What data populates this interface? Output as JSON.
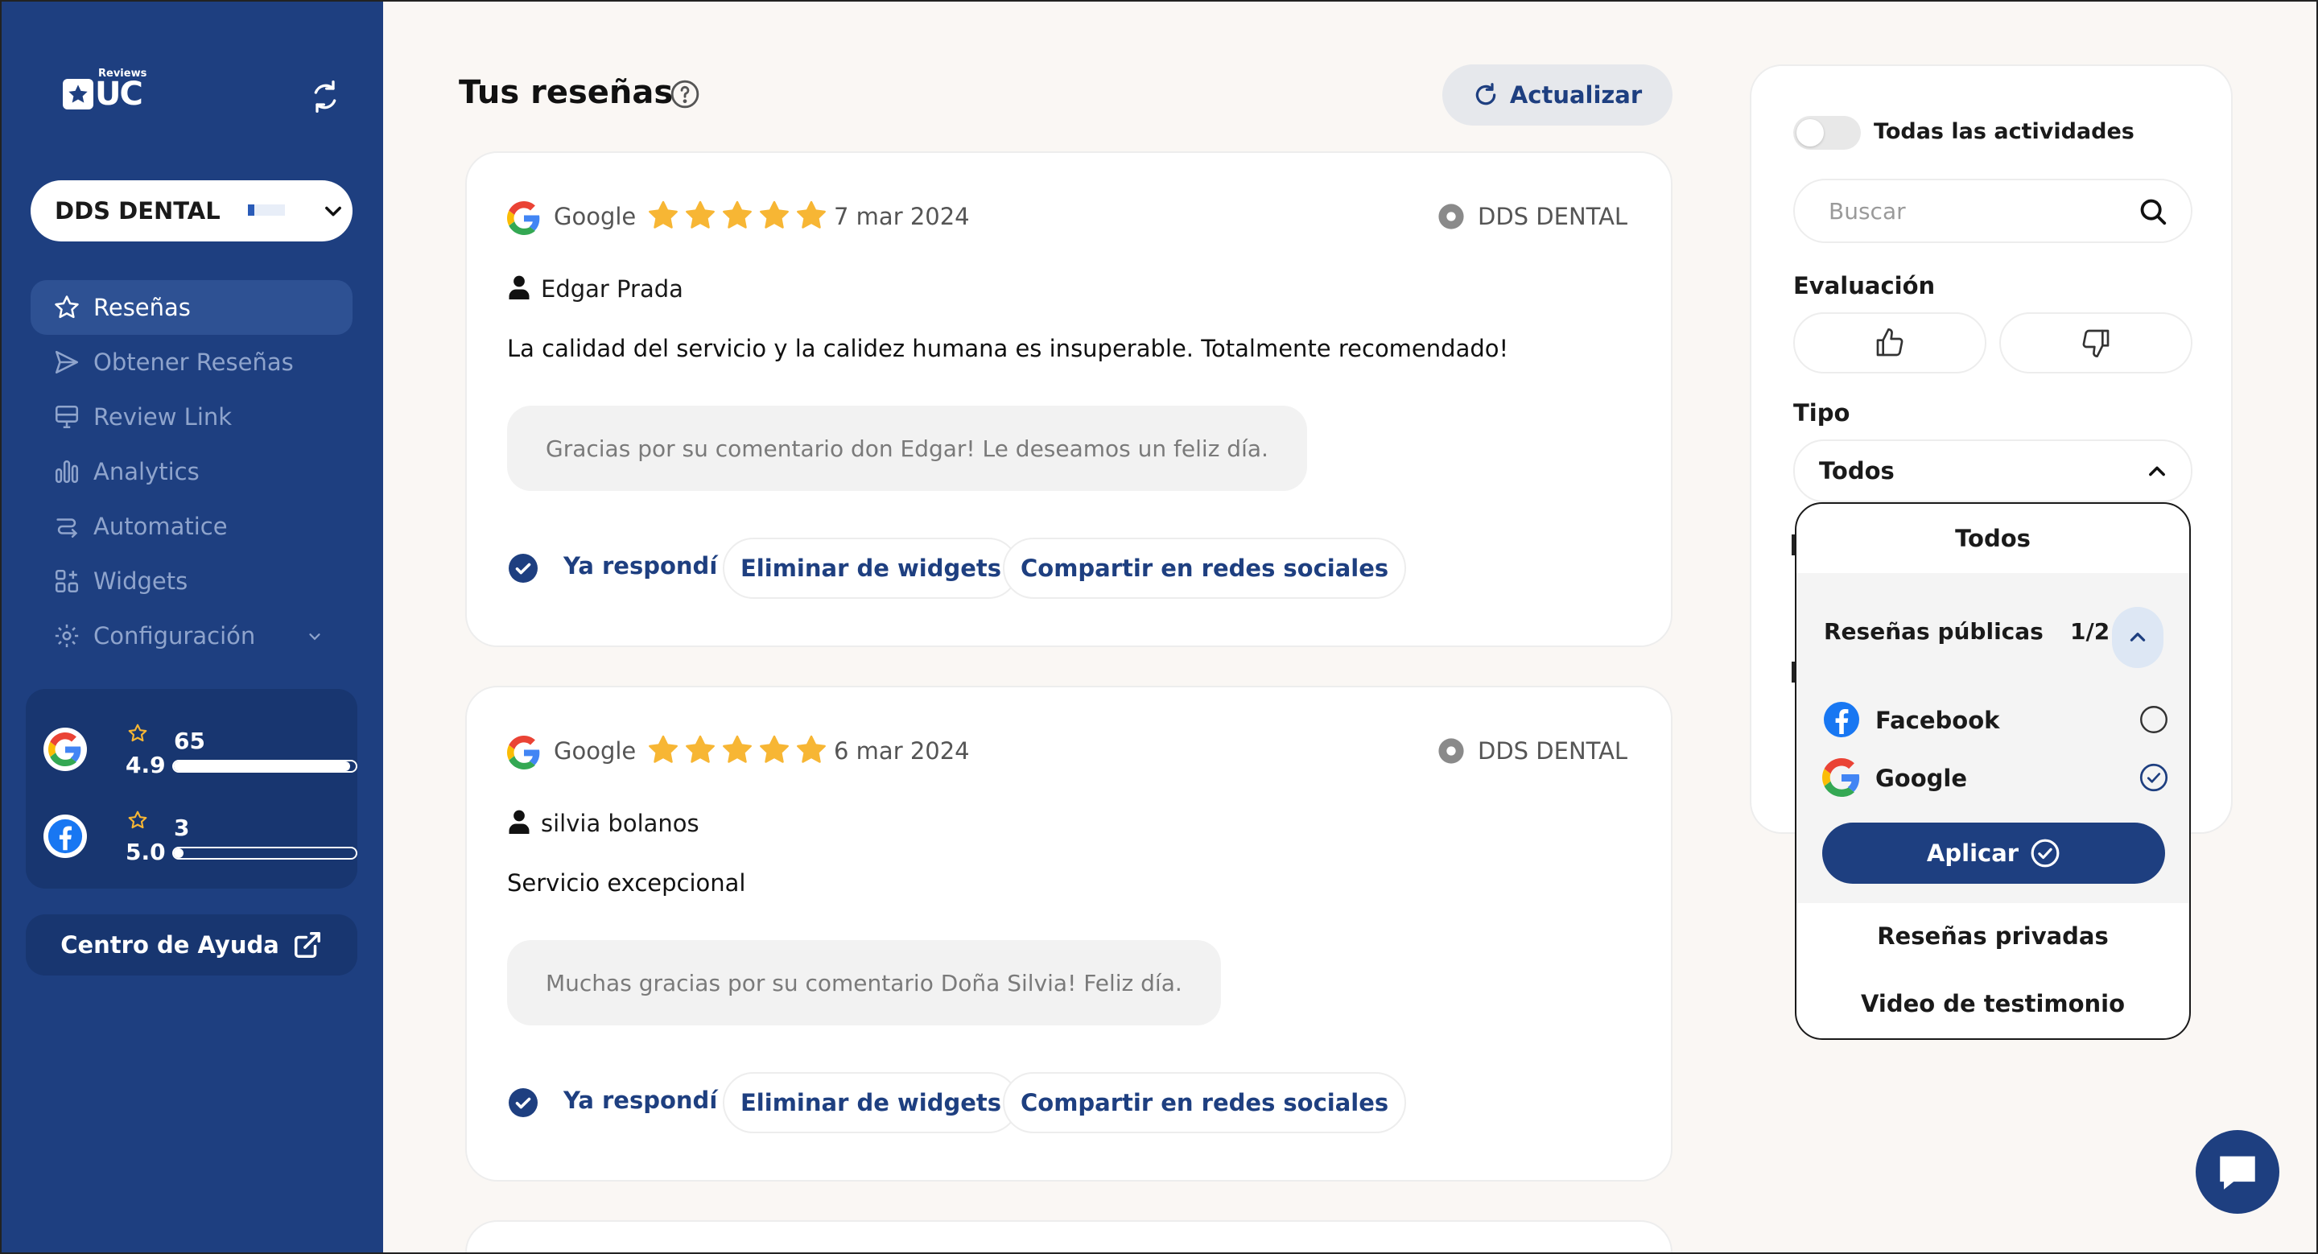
{
  "brand": {
    "logo_text": "UC",
    "logo_sup": "Reviews"
  },
  "sidebar": {
    "account": "DDS DENTAL",
    "items": [
      {
        "label": "Reseñas",
        "icon": "star-icon"
      },
      {
        "label": "Obtener Reseñas",
        "icon": "send-icon"
      },
      {
        "label": "Review Link",
        "icon": "monitor-icon"
      },
      {
        "label": "Analytics",
        "icon": "bar-chart-icon"
      },
      {
        "label": "Automatice",
        "icon": "automation-icon"
      },
      {
        "label": "Widgets",
        "icon": "widgets-icon"
      },
      {
        "label": "Configuración",
        "icon": "gear-icon"
      }
    ],
    "stats": [
      {
        "platform": "Google",
        "rating": "4.9",
        "count": "65",
        "fill": 0.97
      },
      {
        "platform": "Facebook",
        "rating": "5.0",
        "count": "3",
        "fill": 0.02
      }
    ],
    "help": "Centro de Ayuda"
  },
  "main": {
    "title": "Tus reseñas",
    "refresh": "Actualizar",
    "reviews": [
      {
        "platform": "Google",
        "stars": 5,
        "date": "7 mar 2024",
        "location": "DDS DENTAL",
        "author": "Edgar Prada",
        "text": "La calidad del servicio y la calidez humana es insuperable. Totalmente recomendado!",
        "reply": "Gracias por su comentario don Edgar! Le deseamos un feliz día.",
        "replied": "Ya respondí",
        "remove": "Eliminar de widgets",
        "share": "Compartir en redes sociales"
      },
      {
        "platform": "Google",
        "stars": 5,
        "date": "6 mar 2024",
        "location": "DDS DENTAL",
        "author": "silvia bolanos",
        "text": "Servicio excepcional",
        "reply": "Muchas gracias por su comentario Doña Silvia! Feliz día.",
        "replied": "Ya respondí",
        "remove": "Eliminar de widgets",
        "share": "Compartir en redes sociales"
      }
    ]
  },
  "filters": {
    "toggle_label": "Todas las actividades",
    "search_placeholder": "Buscar",
    "evaluation_label": "Evaluación",
    "type_label": "Tipo",
    "type_value": "Todos",
    "dropdown": {
      "all": "Todos",
      "public_group": "Reseñas públicas",
      "public_count": "1/2",
      "platforms": [
        {
          "label": "Facebook",
          "checked": false
        },
        {
          "label": "Google",
          "checked": true
        }
      ],
      "apply": "Aplicar",
      "private": "Reseñas privadas",
      "video": "Video de testimonio"
    }
  },
  "colors": {
    "primary": "#1e3f80",
    "star": "#f7b634",
    "background": "#faf7f4"
  }
}
